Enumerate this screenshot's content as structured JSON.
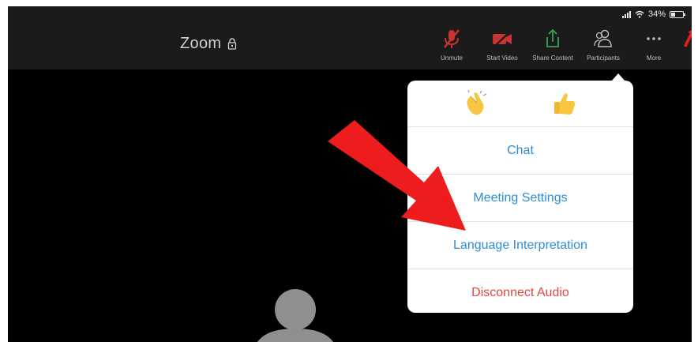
{
  "status_bar": {
    "battery": "34%"
  },
  "header": {
    "title": "Zoom"
  },
  "toolbar": {
    "items": [
      {
        "label": "Unmute"
      },
      {
        "label": "Start Video"
      },
      {
        "label": "Share Content"
      },
      {
        "label": "Participants"
      },
      {
        "label": "More"
      }
    ]
  },
  "more_menu": {
    "reactions": [
      "clapping-hands",
      "thumbs-up"
    ],
    "items": [
      {
        "label": "Chat"
      },
      {
        "label": "Meeting Settings"
      },
      {
        "label": "Language Interpretation"
      },
      {
        "label": "Disconnect Audio"
      }
    ]
  },
  "colors": {
    "menu_text": "#2d8cd6",
    "danger_text": "#e0473f",
    "muted_red": "#c8342f",
    "share_green": "#33a651",
    "arrow_red": "#ee1c1c"
  }
}
